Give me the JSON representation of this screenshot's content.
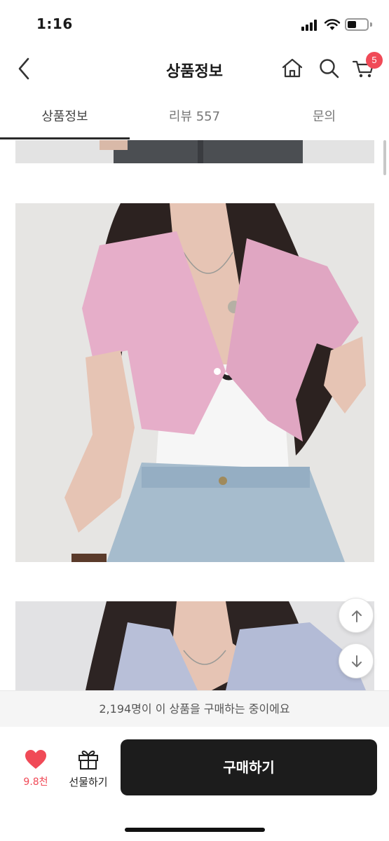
{
  "status_bar": {
    "time": "1:16"
  },
  "header": {
    "title": "상품정보",
    "cart_count": "5"
  },
  "tabs": [
    {
      "label": "상품정보",
      "active": true
    },
    {
      "label": "리뷰 557",
      "active": false
    },
    {
      "label": "문의",
      "active": false
    }
  ],
  "buyers_banner": "2,194명이 이 상품을 구매하는 중이에요",
  "bottom_bar": {
    "like_count": "9.8천",
    "gift_label": "선물하기",
    "buy_label": "구매하기"
  },
  "colors": {
    "accent": "#f04a57",
    "buy_button": "#1c1c1c",
    "tab_indicator": "#2a2a2a"
  },
  "icons": [
    "back-arrow-icon",
    "home-icon",
    "search-icon",
    "cart-icon",
    "scroll-up-icon",
    "scroll-down-icon",
    "heart-icon",
    "gift-icon"
  ]
}
